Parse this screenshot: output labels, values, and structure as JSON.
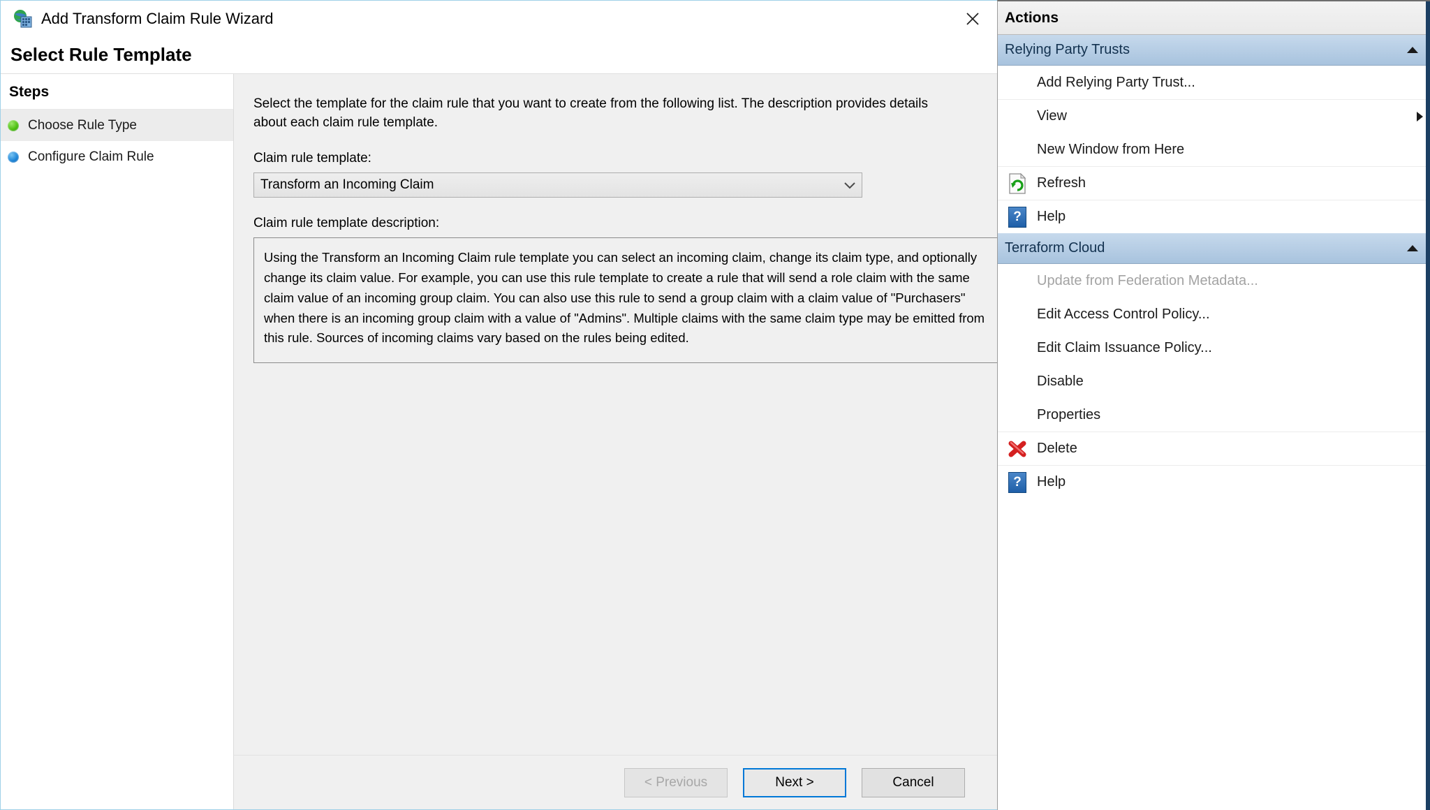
{
  "window": {
    "title": "Add Transform Claim Rule Wizard",
    "title_icon": "globe-database-icon",
    "close_icon": "close-icon",
    "page_heading": "Select Rule Template"
  },
  "steps": {
    "title": "Steps",
    "items": [
      {
        "label": "Choose Rule Type",
        "bullet": "green-bullet-icon",
        "state": "complete",
        "active": true
      },
      {
        "label": "Configure Claim Rule",
        "bullet": "blue-bullet-icon",
        "state": "current",
        "active": false
      }
    ]
  },
  "main": {
    "intro": "Select the template for the claim rule that you want to create from the following list. The description provides details about each claim rule template.",
    "template_label": "Claim rule template:",
    "template_value": "Transform an Incoming Claim",
    "template_dropdown_icon": "chevron-down-icon",
    "description_label": "Claim rule template description:",
    "description_text": "Using the Transform an Incoming Claim rule template you can select an incoming claim, change its claim type, and optionally change its claim value.  For example, you can use this rule template to create a rule that will send a role claim with the same claim value of an incoming group claim.  You can also use this rule to send a group claim with a claim value of \"Purchasers\" when there is an incoming group claim with a value of \"Admins\".  Multiple claims with the same claim type may be emitted from this rule.  Sources of incoming claims vary based on the rules being edited."
  },
  "footer": {
    "previous_label": "< Previous",
    "next_label": "Next >",
    "cancel_label": "Cancel"
  },
  "actions": {
    "header": "Actions",
    "groups": [
      {
        "title": "Relying Party Trusts",
        "collapse_icon": "chevron-up-icon",
        "items": [
          {
            "label": "Add Relying Party Trust...",
            "icon": null,
            "disabled": false,
            "separator": false,
            "submenu_icon": null
          },
          {
            "label": "View",
            "icon": null,
            "disabled": false,
            "separator": true,
            "submenu_icon": "chevron-right-icon"
          },
          {
            "label": "New Window from Here",
            "icon": null,
            "disabled": false,
            "separator": false,
            "submenu_icon": null
          },
          {
            "label": "Refresh",
            "icon": "refresh-icon",
            "disabled": false,
            "separator": true,
            "submenu_icon": null
          },
          {
            "label": "Help",
            "icon": "help-icon",
            "disabled": false,
            "separator": true,
            "submenu_icon": null
          }
        ]
      },
      {
        "title": "Terraform Cloud",
        "collapse_icon": "chevron-up-icon",
        "items": [
          {
            "label": "Update from Federation Metadata...",
            "icon": null,
            "disabled": true,
            "separator": false,
            "submenu_icon": null
          },
          {
            "label": "Edit Access Control Policy...",
            "icon": null,
            "disabled": false,
            "separator": false,
            "submenu_icon": null
          },
          {
            "label": "Edit Claim Issuance Policy...",
            "icon": null,
            "disabled": false,
            "separator": false,
            "submenu_icon": null
          },
          {
            "label": "Disable",
            "icon": null,
            "disabled": false,
            "separator": false,
            "submenu_icon": null
          },
          {
            "label": "Properties",
            "icon": null,
            "disabled": false,
            "separator": false,
            "submenu_icon": null
          },
          {
            "label": "Delete",
            "icon": "delete-icon",
            "disabled": false,
            "separator": true,
            "submenu_icon": null
          },
          {
            "label": "Help",
            "icon": "help-icon",
            "disabled": false,
            "separator": true,
            "submenu_icon": null
          }
        ]
      }
    ]
  },
  "colors": {
    "accent": "#0078d7",
    "group_header": "#a8c3de",
    "delete_red": "#d42020",
    "refresh_green": "#19a019"
  }
}
